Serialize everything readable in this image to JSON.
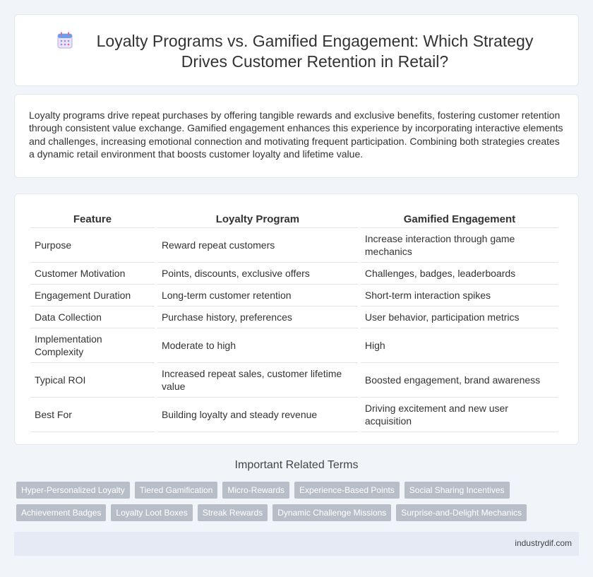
{
  "header": {
    "title": "Loyalty Programs vs. Gamified Engagement: Which Strategy Drives Customer Retention in Retail?",
    "icon": "calendar-icon"
  },
  "intro": "Loyalty programs drive repeat purchases by offering tangible rewards and exclusive benefits, fostering customer retention through consistent value exchange. Gamified engagement enhances this experience by incorporating interactive elements and challenges, increasing emotional connection and motivating frequent participation. Combining both strategies creates a dynamic retail environment that boosts customer loyalty and lifetime value.",
  "table": {
    "headers": [
      "Feature",
      "Loyalty Program",
      "Gamified Engagement"
    ],
    "rows": [
      [
        "Purpose",
        "Reward repeat customers",
        "Increase interaction through game mechanics"
      ],
      [
        "Customer Motivation",
        "Points, discounts, exclusive offers",
        "Challenges, badges, leaderboards"
      ],
      [
        "Engagement Duration",
        "Long-term customer retention",
        "Short-term interaction spikes"
      ],
      [
        "Data Collection",
        "Purchase history, preferences",
        "User behavior, participation metrics"
      ],
      [
        "Implementation Complexity",
        "Moderate to high",
        "High"
      ],
      [
        "Typical ROI",
        "Increased repeat sales, customer lifetime value",
        "Boosted engagement, brand awareness"
      ],
      [
        "Best For",
        "Building loyalty and steady revenue",
        "Driving excitement and new user acquisition"
      ]
    ]
  },
  "related": {
    "heading": "Important Related Terms",
    "row1": [
      "Hyper-Personalized Loyalty",
      "Tiered Gamification",
      "Micro-Rewards",
      "Experience-Based Points",
      "Social Sharing Incentives"
    ],
    "row2": [
      "Achievement Badges",
      "Loyalty Loot Boxes",
      "Streak Rewards",
      "Dynamic Challenge Missions",
      "Surprise-and-Delight Mechanics"
    ]
  },
  "footer": {
    "source": "industrydif.com"
  },
  "colors": {
    "background": "#f1f4f9",
    "tag": "#b8bec8",
    "footer": "#e6eaf4"
  }
}
